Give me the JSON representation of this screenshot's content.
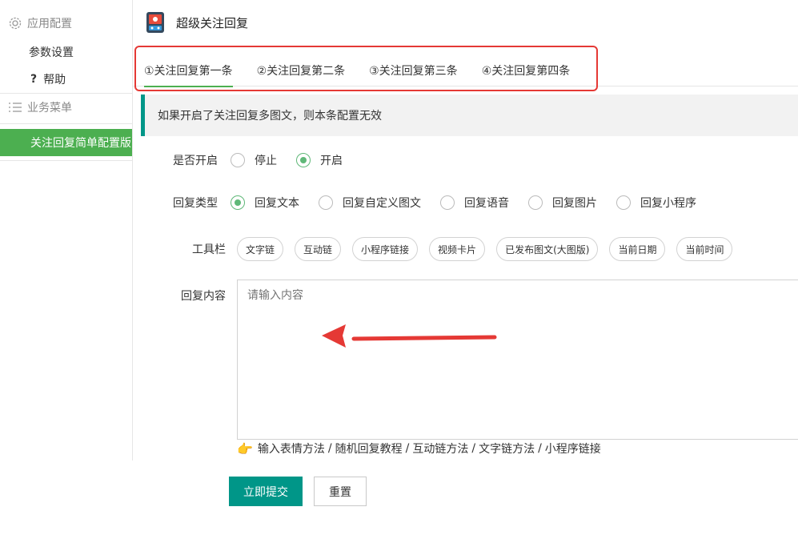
{
  "sidebar": {
    "app_config": "应用配置",
    "items": [
      {
        "label": "参数设置"
      },
      {
        "label": "帮助",
        "icon": "?"
      }
    ],
    "business_menu": "业务菜单",
    "active_item": "关注回复简单配置版"
  },
  "header": {
    "title": "超级关注回复",
    "logo_icon": "app-logo"
  },
  "tabs": [
    {
      "label": "①关注回复第一条",
      "active": true
    },
    {
      "label": "②关注回复第二条",
      "active": false
    },
    {
      "label": "③关注回复第三条",
      "active": false
    },
    {
      "label": "④关注回复第四条",
      "active": false
    }
  ],
  "notice": "如果开启了关注回复多图文，则本条配置无效",
  "enable": {
    "label": "是否开启",
    "options": [
      {
        "label": "停止",
        "checked": false
      },
      {
        "label": "开启",
        "checked": true
      }
    ]
  },
  "reply_type": {
    "label": "回复类型",
    "options": [
      {
        "label": "回复文本",
        "checked": true
      },
      {
        "label": "回复自定义图文",
        "checked": false
      },
      {
        "label": "回复语音",
        "checked": false
      },
      {
        "label": "回复图片",
        "checked": false
      },
      {
        "label": "回复小程序",
        "checked": false
      }
    ]
  },
  "toolbar": {
    "label": "工具栏",
    "buttons": [
      "文字链",
      "互动链",
      "小程序链接",
      "视频卡片",
      "已发布图文(大图版)",
      "当前日期",
      "当前时间"
    ]
  },
  "content": {
    "label": "回复内容",
    "placeholder": "请输入内容",
    "value": ""
  },
  "help": {
    "icon": "pointing-hand",
    "links": [
      "输入表情方法",
      "随机回复教程",
      "互动链方法",
      "文字链方法",
      "小程序链接"
    ],
    "separator": "/"
  },
  "actions": {
    "submit": "立即提交",
    "reset": "重置"
  },
  "colors": {
    "accent": "#009688",
    "sidebar_active": "#4caf50",
    "radio": "#5fb878",
    "annotation": "#e53935"
  }
}
